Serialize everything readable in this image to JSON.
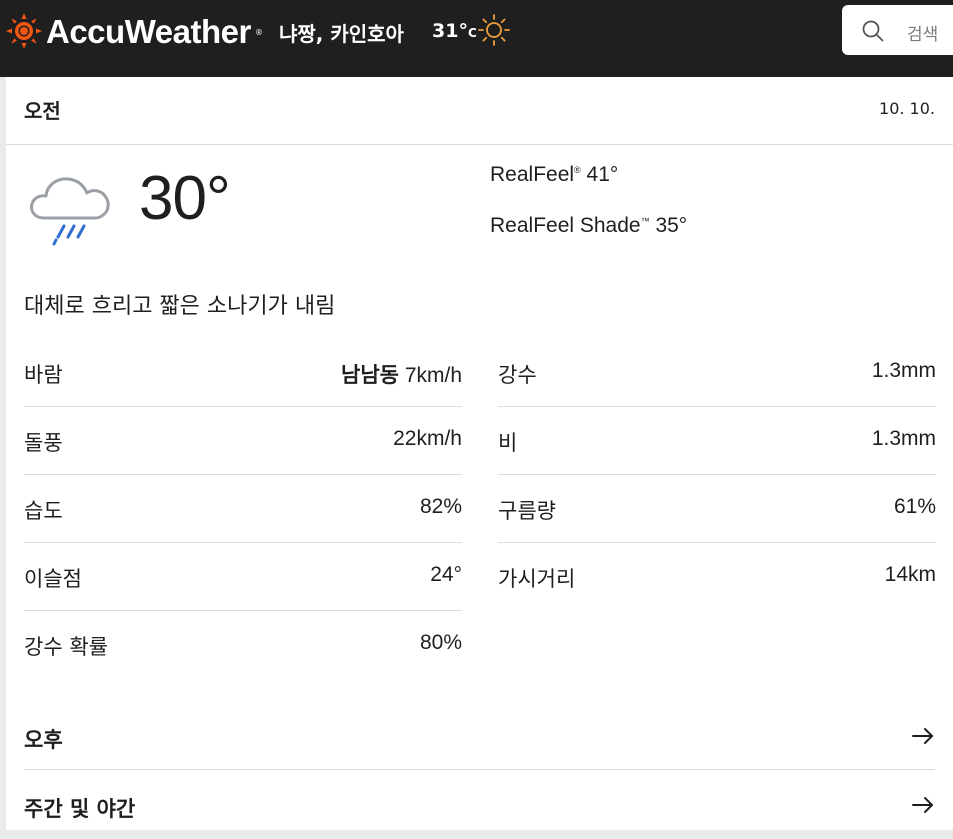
{
  "header": {
    "brand": "AccuWeather",
    "brand_mark": "®",
    "location": "냐짱, 카인호아",
    "temp": "31°",
    "temp_unit": "C",
    "search_label": "검색",
    "colors": {
      "bar": "#1f1f1f",
      "accent_sun": "#f05514"
    }
  },
  "period": {
    "title": "오전",
    "date": "10. 10."
  },
  "current": {
    "icon": "cloud-rain-icon",
    "temperature": "30°",
    "realfeel_label": "RealFeel",
    "realfeel_mark": "®",
    "realfeel_value": "41°",
    "realfeel_shade_label": "RealFeel Shade",
    "realfeel_shade_mark": "™",
    "realfeel_shade_value": "35°",
    "phrase": "대체로 흐리고 짧은 소나기가 내림"
  },
  "details_left": [
    {
      "label": "바람",
      "direction": "남남동",
      "value": "7km/h"
    },
    {
      "label": "돌풍",
      "value": "22km/h"
    },
    {
      "label": "습도",
      "value": "82%"
    },
    {
      "label": "이슬점",
      "value": "24°"
    },
    {
      "label": "강수 확률",
      "value": "80%"
    }
  ],
  "details_right": [
    {
      "label": "강수",
      "value": "1.3mm"
    },
    {
      "label": "비",
      "value": "1.3mm"
    },
    {
      "label": "구름량",
      "value": "61%"
    },
    {
      "label": "가시거리",
      "value": "14km"
    }
  ],
  "nav": {
    "afternoon": "오후",
    "day_night": "주간 및 야간"
  }
}
